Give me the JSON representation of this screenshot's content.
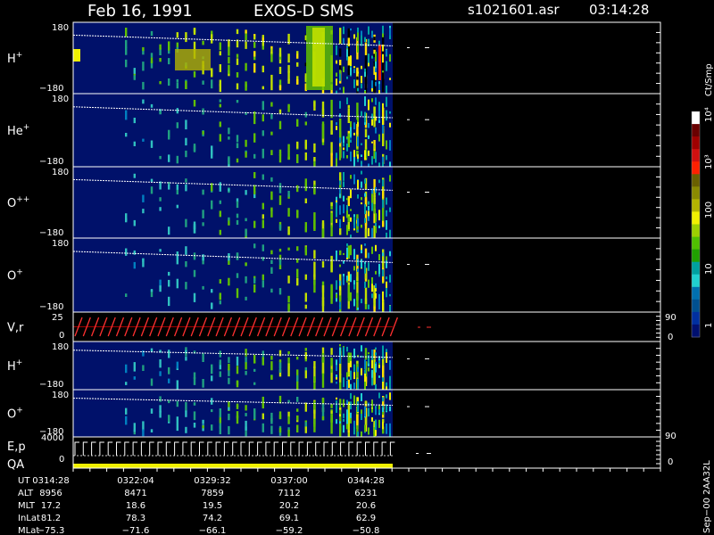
{
  "header": {
    "date": "Feb 16, 1991",
    "instrument": "EXOS-D SMS",
    "file": "s1021601.asr",
    "time": "03:14:28"
  },
  "colorbar": {
    "unit": "Ct/Smp",
    "ticks": [
      "10⁴",
      "10³",
      "100",
      "10",
      "1"
    ],
    "colors": [
      "#ffffff",
      "#6a0000",
      "#a00000",
      "#d01010",
      "#ff2000",
      "#6a6000",
      "#8a8a00",
      "#b4b400",
      "#f0f000",
      "#9cd000",
      "#50c000",
      "#20a000",
      "#00a0a0",
      "#20d0d0",
      "#0070b0",
      "#005090",
      "#0030a0",
      "#001070"
    ]
  },
  "panels": [
    {
      "label": "H",
      "sup": "+",
      "ytop": "180",
      "ybot": "−180"
    },
    {
      "label": "He",
      "sup": "+",
      "ytop": "180",
      "ybot": "−180"
    },
    {
      "label": "O",
      "sup": "++",
      "ytop": "180",
      "ybot": "−180"
    },
    {
      "label": "O",
      "sup": "+",
      "ytop": "180",
      "ybot": "−180"
    },
    {
      "label": "V,r",
      "sup": "",
      "ytop": "25",
      "ybot": "0",
      "rtop": "90",
      "rbot": "0"
    },
    {
      "label": "H",
      "sup": "+",
      "ytop": "180",
      "ybot": "−180"
    },
    {
      "label": "O",
      "sup": "+",
      "ytop": "180",
      "ybot": "−180"
    },
    {
      "label": "E,p",
      "sup": "",
      "label2": "QA",
      "ytop": "4000",
      "ybot": "0",
      "rtop": "90",
      "rbot": "0"
    }
  ],
  "chart_data": {
    "type": "heatmap",
    "title": "Feb 16, 1991  EXOS-D SMS",
    "xlabel": "UT",
    "x_ticks": [
      "0314:28",
      "0322:04",
      "0329:32",
      "0337:00",
      "0344:28"
    ],
    "ylabel_unit": "Ct/Smp",
    "y_range_pitch": [
      -180,
      180
    ],
    "color_scale": "log",
    "color_range": [
      1,
      10000
    ],
    "series": [
      {
        "name": "H+"
      },
      {
        "name": "He+"
      },
      {
        "name": "O++"
      },
      {
        "name": "O+"
      },
      {
        "name": "V,r",
        "ylim": [
          0,
          25
        ],
        "right_ylim": [
          0,
          90
        ]
      },
      {
        "name": "H+"
      },
      {
        "name": "O+"
      },
      {
        "name": "E,p",
        "ylim": [
          0,
          4000
        ],
        "right_ylim": [
          0,
          90
        ]
      }
    ]
  },
  "table": {
    "rows": [
      {
        "label": "UT",
        "values": [
          "0314:28",
          "0322:04",
          "0329:32",
          "0337:00",
          "0344:28"
        ]
      },
      {
        "label": "ALT",
        "values": [
          "8956",
          "8471",
          "7859",
          "7112",
          "6231"
        ]
      },
      {
        "label": "MLT",
        "values": [
          "17.2",
          "18.6",
          "19.5",
          "20.2",
          "20.6"
        ]
      },
      {
        "label": "InLat",
        "values": [
          "81.2",
          "78.3",
          "74.2",
          "69.1",
          "62.9"
        ]
      },
      {
        "label": "MLat",
        "values": [
          "−75.3",
          "−71.6",
          "−66.1",
          "−59.2",
          "−50.8"
        ]
      }
    ]
  },
  "footer": {
    "vertical": "Sep−00  2AA32L"
  }
}
